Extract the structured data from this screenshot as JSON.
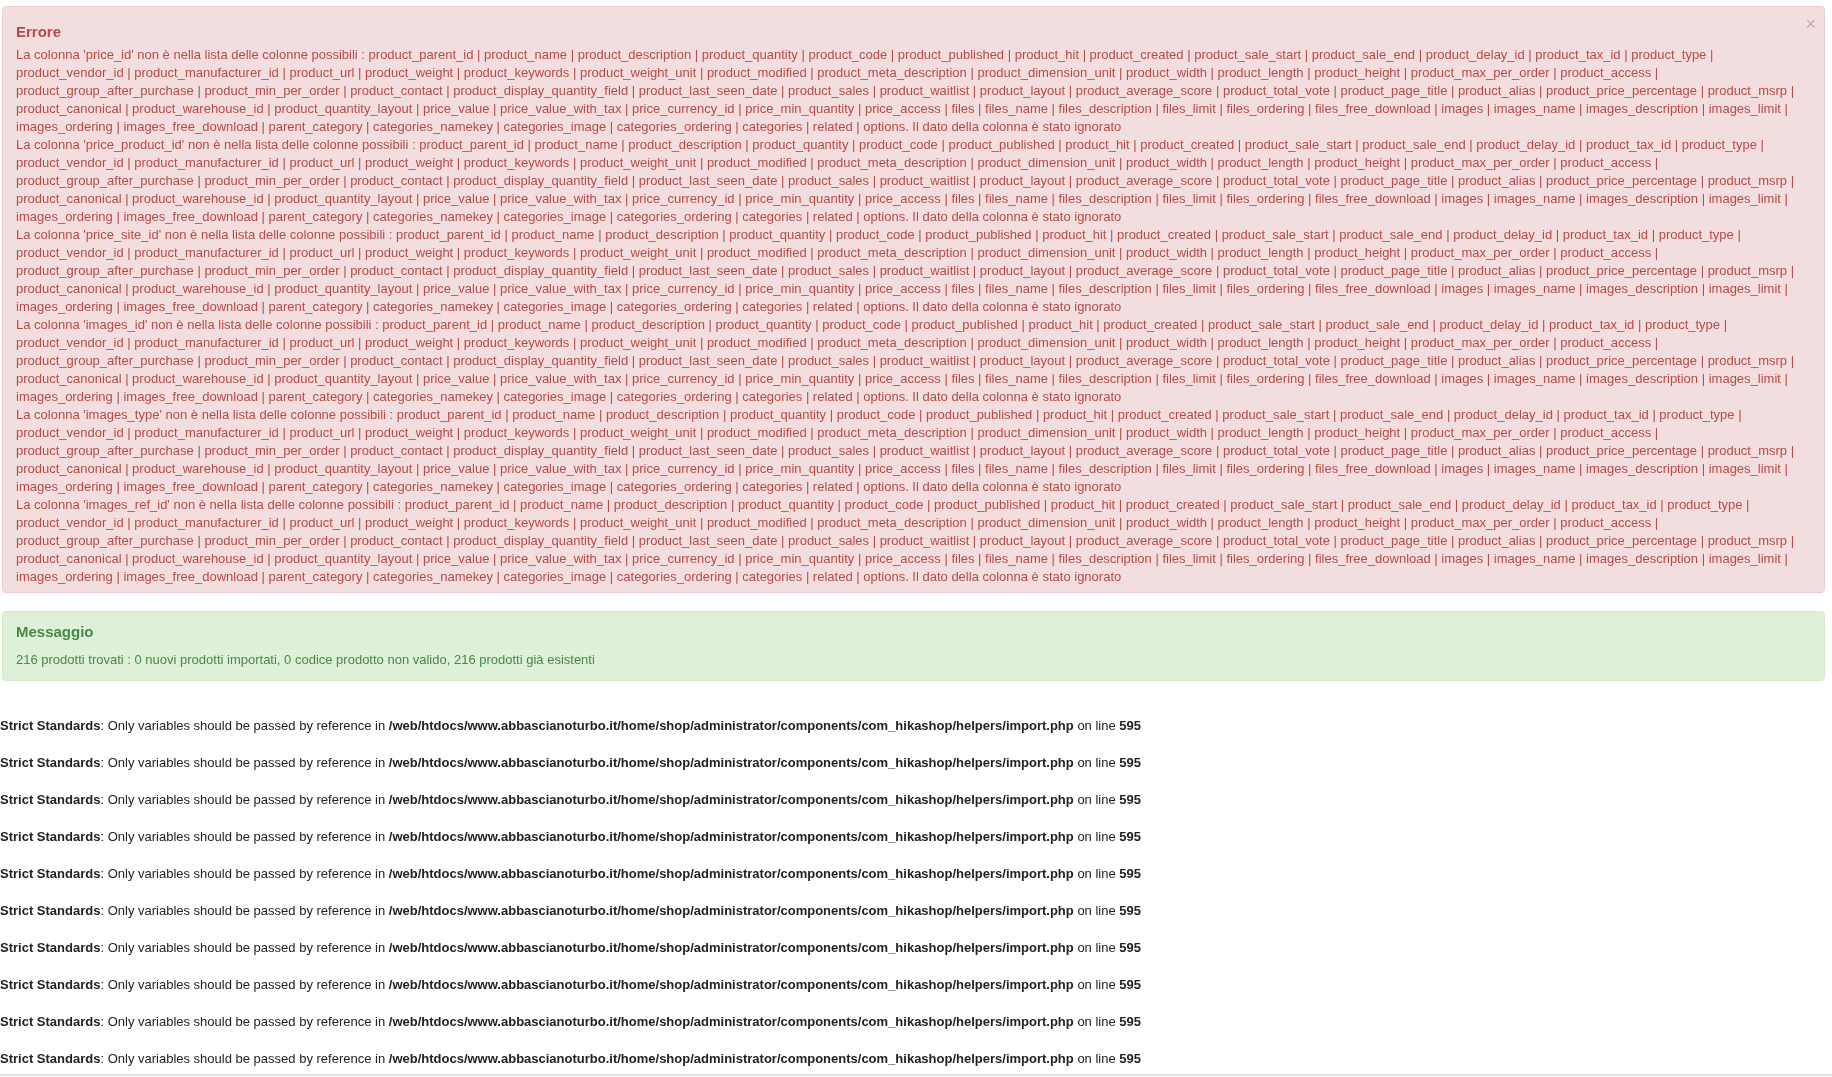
{
  "error_box": {
    "title": "Errore",
    "close": "×",
    "messages": [
      "La colonna 'price_id' non è nella lista delle colonne possibili : product_parent_id | product_name | product_description | product_quantity | product_code | product_published | product_hit | product_created | product_sale_start | product_sale_end | product_delay_id | product_tax_id | product_type | product_vendor_id | product_manufacturer_id | product_url | product_weight | product_keywords | product_weight_unit | product_modified | product_meta_description | product_dimension_unit | product_width | product_length | product_height | product_max_per_order | product_access | product_group_after_purchase | product_min_per_order | product_contact | product_display_quantity_field | product_last_seen_date | product_sales | product_waitlist | product_layout | product_average_score | product_total_vote | product_page_title | product_alias | product_price_percentage | product_msrp | product_canonical | product_warehouse_id | product_quantity_layout | price_value | price_value_with_tax | price_currency_id | price_min_quantity | price_access | files | files_name | files_description | files_limit | files_ordering | files_free_download | images | images_name | images_description | images_limit | images_ordering | images_free_download | parent_category | categories_namekey | categories_image | categories_ordering | categories | related | options. Il dato della colonna è stato ignorato",
      "La colonna 'price_product_id' non è nella lista delle colonne possibili : product_parent_id | product_name | product_description | product_quantity | product_code | product_published | product_hit | product_created | product_sale_start | product_sale_end | product_delay_id | product_tax_id | product_type | product_vendor_id | product_manufacturer_id | product_url | product_weight | product_keywords | product_weight_unit | product_modified | product_meta_description | product_dimension_unit | product_width | product_length | product_height | product_max_per_order | product_access | product_group_after_purchase | product_min_per_order | product_contact | product_display_quantity_field | product_last_seen_date | product_sales | product_waitlist | product_layout | product_average_score | product_total_vote | product_page_title | product_alias | product_price_percentage | product_msrp | product_canonical | product_warehouse_id | product_quantity_layout | price_value | price_value_with_tax | price_currency_id | price_min_quantity | price_access | files | files_name | files_description | files_limit | files_ordering | files_free_download | images | images_name | images_description | images_limit | images_ordering | images_free_download | parent_category | categories_namekey | categories_image | categories_ordering | categories | related | options. Il dato della colonna è stato ignorato",
      "La colonna 'price_site_id' non è nella lista delle colonne possibili : product_parent_id | product_name | product_description | product_quantity | product_code | product_published | product_hit | product_created | product_sale_start | product_sale_end | product_delay_id | product_tax_id | product_type | product_vendor_id | product_manufacturer_id | product_url | product_weight | product_keywords | product_weight_unit | product_modified | product_meta_description | product_dimension_unit | product_width | product_length | product_height | product_max_per_order | product_access | product_group_after_purchase | product_min_per_order | product_contact | product_display_quantity_field | product_last_seen_date | product_sales | product_waitlist | product_layout | product_average_score | product_total_vote | product_page_title | product_alias | product_price_percentage | product_msrp | product_canonical | product_warehouse_id | product_quantity_layout | price_value | price_value_with_tax | price_currency_id | price_min_quantity | price_access | files | files_name | files_description | files_limit | files_ordering | files_free_download | images | images_name | images_description | images_limit | images_ordering | images_free_download | parent_category | categories_namekey | categories_image | categories_ordering | categories | related | options. Il dato della colonna è stato ignorato",
      "La colonna 'images_id' non è nella lista delle colonne possibili : product_parent_id | product_name | product_description | product_quantity | product_code | product_published | product_hit | product_created | product_sale_start | product_sale_end | product_delay_id | product_tax_id | product_type | product_vendor_id | product_manufacturer_id | product_url | product_weight | product_keywords | product_weight_unit | product_modified | product_meta_description | product_dimension_unit | product_width | product_length | product_height | product_max_per_order | product_access | product_group_after_purchase | product_min_per_order | product_contact | product_display_quantity_field | product_last_seen_date | product_sales | product_waitlist | product_layout | product_average_score | product_total_vote | product_page_title | product_alias | product_price_percentage | product_msrp | product_canonical | product_warehouse_id | product_quantity_layout | price_value | price_value_with_tax | price_currency_id | price_min_quantity | price_access | files | files_name | files_description | files_limit | files_ordering | files_free_download | images | images_name | images_description | images_limit | images_ordering | images_free_download | parent_category | categories_namekey | categories_image | categories_ordering | categories | related | options. Il dato della colonna è stato ignorato",
      "La colonna 'images_type' non è nella lista delle colonne possibili : product_parent_id | product_name | product_description | product_quantity | product_code | product_published | product_hit | product_created | product_sale_start | product_sale_end | product_delay_id | product_tax_id | product_type | product_vendor_id | product_manufacturer_id | product_url | product_weight | product_keywords | product_weight_unit | product_modified | product_meta_description | product_dimension_unit | product_width | product_length | product_height | product_max_per_order | product_access | product_group_after_purchase | product_min_per_order | product_contact | product_display_quantity_field | product_last_seen_date | product_sales | product_waitlist | product_layout | product_average_score | product_total_vote | product_page_title | product_alias | product_price_percentage | product_msrp | product_canonical | product_warehouse_id | product_quantity_layout | price_value | price_value_with_tax | price_currency_id | price_min_quantity | price_access | files | files_name | files_description | files_limit | files_ordering | files_free_download | images | images_name | images_description | images_limit | images_ordering | images_free_download | parent_category | categories_namekey | categories_image | categories_ordering | categories | related | options. Il dato della colonna è stato ignorato",
      "La colonna 'images_ref_id' non è nella lista delle colonne possibili : product_parent_id | product_name | product_description | product_quantity | product_code | product_published | product_hit | product_created | product_sale_start | product_sale_end | product_delay_id | product_tax_id | product_type | product_vendor_id | product_manufacturer_id | product_url | product_weight | product_keywords | product_weight_unit | product_modified | product_meta_description | product_dimension_unit | product_width | product_length | product_height | product_max_per_order | product_access | product_group_after_purchase | product_min_per_order | product_contact | product_display_quantity_field | product_last_seen_date | product_sales | product_waitlist | product_layout | product_average_score | product_total_vote | product_page_title | product_alias | product_price_percentage | product_msrp | product_canonical | product_warehouse_id | product_quantity_layout | price_value | price_value_with_tax | price_currency_id | price_min_quantity | price_access | files | files_name | files_description | files_limit | files_ordering | files_free_download | images | images_name | images_description | images_limit | images_ordering | images_free_download | parent_category | categories_namekey | categories_image | categories_ordering | categories | related | options. Il dato della colonna è stato ignorato"
    ]
  },
  "message_box": {
    "title": "Messaggio",
    "text": "216 prodotti trovati : 0 nuovi prodotti importati, 0 codice prodotto non valido, 216 prodotti già esistenti"
  },
  "warnings": [
    {
      "label": "Strict Standards",
      "text": ": Only variables should be passed by reference in ",
      "file": "/web/htdocs/www.abbascianoturbo.it/home/shop/administrator/components/com_hikashop/helpers/import.php",
      "on_line": " on line ",
      "line": "595"
    },
    {
      "label": "Strict Standards",
      "text": ": Only variables should be passed by reference in ",
      "file": "/web/htdocs/www.abbascianoturbo.it/home/shop/administrator/components/com_hikashop/helpers/import.php",
      "on_line": " on line ",
      "line": "595"
    },
    {
      "label": "Strict Standards",
      "text": ": Only variables should be passed by reference in ",
      "file": "/web/htdocs/www.abbascianoturbo.it/home/shop/administrator/components/com_hikashop/helpers/import.php",
      "on_line": " on line ",
      "line": "595"
    },
    {
      "label": "Strict Standards",
      "text": ": Only variables should be passed by reference in ",
      "file": "/web/htdocs/www.abbascianoturbo.it/home/shop/administrator/components/com_hikashop/helpers/import.php",
      "on_line": " on line ",
      "line": "595"
    },
    {
      "label": "Strict Standards",
      "text": ": Only variables should be passed by reference in ",
      "file": "/web/htdocs/www.abbascianoturbo.it/home/shop/administrator/components/com_hikashop/helpers/import.php",
      "on_line": " on line ",
      "line": "595"
    },
    {
      "label": "Strict Standards",
      "text": ": Only variables should be passed by reference in ",
      "file": "/web/htdocs/www.abbascianoturbo.it/home/shop/administrator/components/com_hikashop/helpers/import.php",
      "on_line": " on line ",
      "line": "595"
    },
    {
      "label": "Strict Standards",
      "text": ": Only variables should be passed by reference in ",
      "file": "/web/htdocs/www.abbascianoturbo.it/home/shop/administrator/components/com_hikashop/helpers/import.php",
      "on_line": " on line ",
      "line": "595"
    },
    {
      "label": "Strict Standards",
      "text": ": Only variables should be passed by reference in ",
      "file": "/web/htdocs/www.abbascianoturbo.it/home/shop/administrator/components/com_hikashop/helpers/import.php",
      "on_line": " on line ",
      "line": "595"
    },
    {
      "label": "Strict Standards",
      "text": ": Only variables should be passed by reference in ",
      "file": "/web/htdocs/www.abbascianoturbo.it/home/shop/administrator/components/com_hikashop/helpers/import.php",
      "on_line": " on line ",
      "line": "595"
    },
    {
      "label": "Strict Standards",
      "text": ": Only variables should be passed by reference in ",
      "file": "/web/htdocs/www.abbascianoturbo.it/home/shop/administrator/components/com_hikashop/helpers/import.php",
      "on_line": " on line ",
      "line": "595"
    }
  ]
}
